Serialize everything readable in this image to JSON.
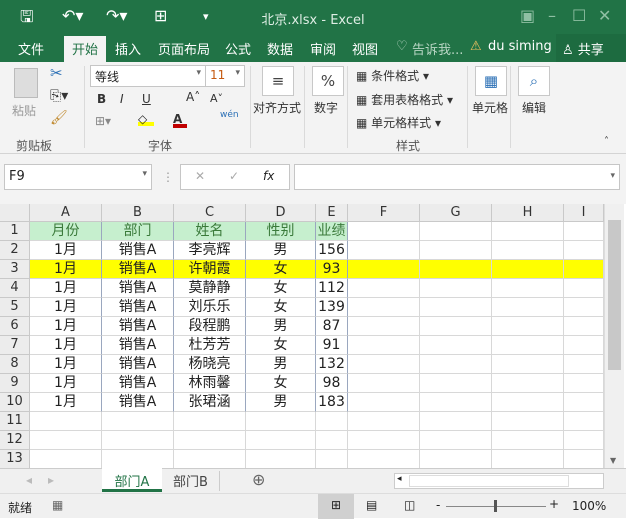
{
  "title": "北京.xlsx - Excel",
  "tabs": [
    "文件",
    "开始",
    "插入",
    "页面布局",
    "公式",
    "数据",
    "审阅",
    "视图"
  ],
  "tell_me": "告诉我...",
  "user": "du siming",
  "share": "共享",
  "ribbon": {
    "paste": "粘贴",
    "clipboard": "剪贴板",
    "font_name": "等线",
    "font_size": "11",
    "bold": "B",
    "italic": "I",
    "underline": "U",
    "font_group": "字体",
    "align": "对齐方式",
    "number": "数字",
    "cond_format": "条件格式",
    "table_format": "套用表格格式",
    "cell_style": "单元格样式",
    "styles": "样式",
    "cells": "单元格",
    "edit": "编辑",
    "wen": "wén"
  },
  "name_box": "F9",
  "fx": "fx",
  "columns": [
    "A",
    "B",
    "C",
    "D",
    "E",
    "F",
    "G",
    "H",
    "I"
  ],
  "rows": [
    [
      "月份",
      "部门",
      "姓名",
      "性别",
      "业绩"
    ],
    [
      "1月",
      "销售A",
      "李亮辉",
      "男",
      "156"
    ],
    [
      "1月",
      "销售A",
      "许朝霞",
      "女",
      "93"
    ],
    [
      "1月",
      "销售A",
      "莫静静",
      "女",
      "112"
    ],
    [
      "1月",
      "销售A",
      "刘乐乐",
      "女",
      "139"
    ],
    [
      "1月",
      "销售A",
      "段程鹏",
      "男",
      "87"
    ],
    [
      "1月",
      "销售A",
      "杜芳芳",
      "女",
      "91"
    ],
    [
      "1月",
      "销售A",
      "杨晓亮",
      "男",
      "132"
    ],
    [
      "1月",
      "销售A",
      "林雨馨",
      "女",
      "98"
    ],
    [
      "1月",
      "销售A",
      "张珺涵",
      "男",
      "183"
    ],
    [
      "",
      "",
      "",
      "",
      ""
    ],
    [
      "",
      "",
      "",
      "",
      ""
    ],
    [
      "",
      "",
      "",
      "",
      ""
    ]
  ],
  "highlight_row": 3,
  "colors": {
    "green": "#217346",
    "header_fill": "#c6efce",
    "highlight": "#ffff00"
  },
  "sheets": [
    "部门A",
    "部门B"
  ],
  "status": "就绪",
  "zoom": "100%"
}
